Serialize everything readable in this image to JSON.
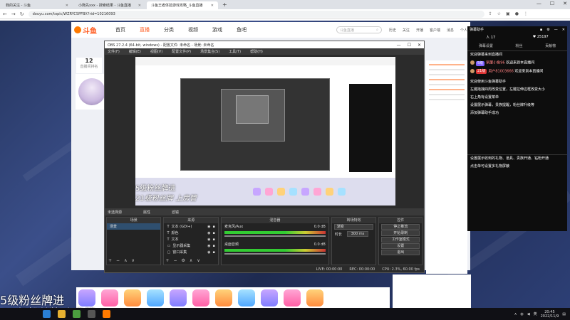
{
  "browser": {
    "tabs": [
      {
        "title": "我的关注 - 斗鱼"
      },
      {
        "title": "小熊先xxx - 搜索结果 - 斗鱼直播"
      },
      {
        "title": "斗鱼王者体验游戏攻略_斗鱼直播"
      }
    ],
    "new_tab": "+",
    "url": "douyu.com/topic/WZRYCSPFBX?rid=10216093",
    "window_controls": [
      "—",
      "☐",
      "✕"
    ]
  },
  "douyu": {
    "logo": "斗鱼",
    "nav": [
      "首页",
      "直播",
      "分类",
      "视频",
      "游戏",
      "鱼吧"
    ],
    "nav_active": "直播",
    "search_placeholder": "斗鱼直播",
    "tools": [
      "历史",
      "关注",
      "开播",
      "客户端",
      "消息",
      "个人"
    ],
    "rank_num": "12",
    "rank_label": "直播间排名"
  },
  "obs": {
    "title": "OBS 27.2.4 (64-bit, windows) - 配置文件: 未命名 - 场景: 未命名",
    "menu": [
      "文件(F)",
      "编辑(E)",
      "视图(V)",
      "配置文件(P)",
      "场景集合(S)",
      "工具(T)",
      "帮助(H)"
    ],
    "scene_bar": [
      "未选择源",
      "属性",
      "滤镜"
    ],
    "docks": {
      "scenes": {
        "title": "场景",
        "items": [
          "场景"
        ]
      },
      "sources": {
        "title": "来源",
        "items": [
          "文本 (GDI+)",
          "颜色",
          "文本",
          "显示器采集",
          "窗口采集"
        ]
      },
      "mixer": {
        "title": "混音器",
        "channels": [
          {
            "name": "麦克风/Aux",
            "db": "0.0 dB"
          },
          {
            "name": "桌面音频",
            "db": "0.0 dB"
          }
        ]
      },
      "transitions": {
        "title": "转场特效",
        "type": "渐变",
        "duration_label": "时长",
        "duration": "300 ms"
      },
      "controls": {
        "title": "控件",
        "buttons": [
          "停止推流",
          "开始录制",
          "工作室模式",
          "设置",
          "退出"
        ]
      }
    },
    "status": {
      "live": "LIVE: 00:00:00",
      "rec": "REC: 00:00:00",
      "cpu": "CPU: 2.3%, 60.00 fps"
    }
  },
  "assistant": {
    "title": "弹幕助手",
    "stats": [
      {
        "label": "人",
        "value": "17"
      },
      {
        "label": "♥",
        "value": "25197"
      }
    ],
    "tabs": [
      "弹幕设置",
      "粉丝",
      "贡献榜"
    ],
    "messages": [
      {
        "text": "欢迎弹幕来到直播间"
      },
      {
        "badge": "5级",
        "name": "粥厦小鱼96",
        "text": "欢迎来到本直播间"
      },
      {
        "badge": "21级",
        "name": "用户81003666",
        "text": "欢迎来到本直播间"
      },
      {
        "text": "欢迎使用斗鱼弹幕助手"
      },
      {
        "text": "左键拖拽四周改变位置，左键拉伸边框改变大小"
      },
      {
        "text": "右上角有设置菜单"
      },
      {
        "text": "设置展示弹幕，贵族提醒，粉丝牌升级等"
      },
      {
        "text": "添加弹幕助手成功"
      },
      {
        "text": "设置展示收到的礼物、道具、贵族开通、钻粉开通"
      },
      {
        "text": "点击单可设置多礼物屏蔽"
      }
    ]
  },
  "overlay": {
    "big_line1": "5级粉丝牌进",
    "big_line2": "21级粉丝牌 上房管"
  },
  "taskbar": {
    "time": "20:45",
    "date": "2022/11/9",
    "tray_lang": "英"
  }
}
